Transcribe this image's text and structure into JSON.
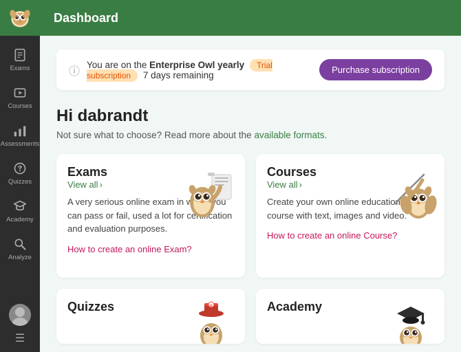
{
  "sidebar": {
    "items": [
      {
        "id": "exams",
        "label": "Exams",
        "icon": "exam"
      },
      {
        "id": "courses",
        "label": "Courses",
        "icon": "courses"
      },
      {
        "id": "assessments",
        "label": "Assessments",
        "icon": "assessments"
      },
      {
        "id": "quizzes",
        "label": "Quizzes",
        "icon": "quizzes"
      },
      {
        "id": "academy",
        "label": "Academy",
        "icon": "academy"
      },
      {
        "id": "analyze",
        "label": "Analyze",
        "icon": "analyze"
      }
    ]
  },
  "topbar": {
    "title": "Dashboard"
  },
  "banner": {
    "text_before": "You are on the ",
    "plan": "Enterprise Owl yearly",
    "badge": "Trial subscription",
    "text_after": " 7 days remaining",
    "button_label": "Purchase subscription"
  },
  "greeting": {
    "title": "Hi dabrandt",
    "subtitle_before": "Not sure what to choose? Read more about the ",
    "subtitle_link": "available formats",
    "subtitle_after": "."
  },
  "cards": [
    {
      "id": "exams",
      "title": "Exams",
      "view_all": "View all",
      "body": "A very serious online exam in which you can pass or fail, used a lot for certification and evaluation purposes.",
      "link": "How to create an online Exam?"
    },
    {
      "id": "courses",
      "title": "Courses",
      "view_all": "View all",
      "body": "Create your own online educational course with text, images and video.",
      "link": "How to create an online Course?"
    }
  ],
  "bottom_cards": [
    {
      "id": "quizzes",
      "title": "Quizzes"
    },
    {
      "id": "academy",
      "title": "Academy"
    }
  ],
  "colors": {
    "green": "#3a7d44",
    "pink": "#c2185b",
    "purple": "#7b3fa0"
  }
}
